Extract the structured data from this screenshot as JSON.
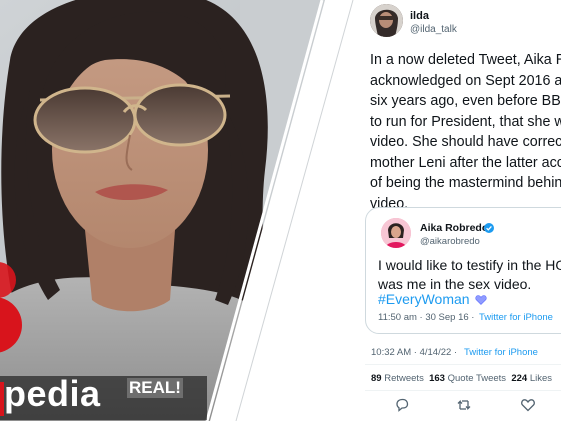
{
  "brand_fragment": "pedia",
  "shirt_text": "REAL!",
  "tweet": {
    "author_name": "ilda",
    "author_handle": "@ilda_talk",
    "body": "In a now deleted Tweet, Aika Ro\nacknowledged on Sept 2016 at\nsix years ago, even before BBM\nto run for President, that she wa\nvideo. She should have correcte\nmother Leni after the latter accu\nof being the mastermind behind\nvideo.",
    "quote": {
      "author_name": "Aika Robredo",
      "author_handle": "@aikarobredo",
      "text": "I would like to testify in the HO\nwas me in the sex video.",
      "hashtag": "#EveryWoman",
      "time": "11:50 am · 30 Sep 16 ·",
      "source": "Twitter for iPhone"
    },
    "time": "10:32 AM · 4/14/22 ·",
    "source": "Twitter for iPhone",
    "stats": {
      "retweets_count": "89",
      "retweets_label": "Retweets",
      "quotes_count": "163",
      "quotes_label": "Quote Tweets",
      "likes_count": "224",
      "likes_label": "Likes"
    }
  },
  "colors": {
    "link": "#1d9bf0",
    "text": "#0f1419",
    "muted": "#536471",
    "verified": "#1d9bf0",
    "sticker_red": "#d8141c"
  },
  "icons": [
    "verified-icon",
    "heart-icon",
    "reply-icon",
    "retweet-icon",
    "like-icon"
  ]
}
